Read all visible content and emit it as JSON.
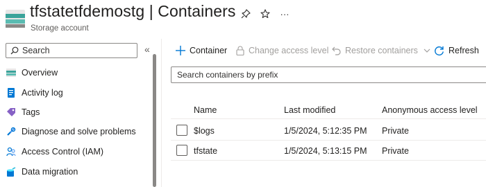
{
  "header": {
    "title": "tfstatetfdemostg | Containers",
    "subtitle": "Storage account",
    "more_label": "···"
  },
  "sidebar": {
    "search_placeholder": "Search",
    "collapse_label": "«",
    "items": [
      {
        "label": "Overview",
        "icon": "storage-overview-icon"
      },
      {
        "label": "Activity log",
        "icon": "activity-log-icon"
      },
      {
        "label": "Tags",
        "icon": "tag-icon"
      },
      {
        "label": "Diagnose and solve problems",
        "icon": "wrench-icon"
      },
      {
        "label": "Access Control (IAM)",
        "icon": "people-icon"
      },
      {
        "label": "Data migration",
        "icon": "data-migration-icon"
      }
    ]
  },
  "toolbar": {
    "add_container": "Container",
    "change_access": "Change access level",
    "restore": "Restore containers",
    "refresh": "Refresh"
  },
  "filter": {
    "placeholder": "Search containers by prefix"
  },
  "table": {
    "headers": [
      "Name",
      "Last modified",
      "Anonymous access level"
    ],
    "rows": [
      {
        "name": "$logs",
        "modified": "1/5/2024, 5:12:35 PM",
        "access": "Private"
      },
      {
        "name": "tfstate",
        "modified": "1/5/2024, 5:13:15 PM",
        "access": "Private"
      }
    ]
  },
  "colors": {
    "accent": "#0078d4",
    "disabled_text": "#a19f9d",
    "border": "#8a8886"
  }
}
